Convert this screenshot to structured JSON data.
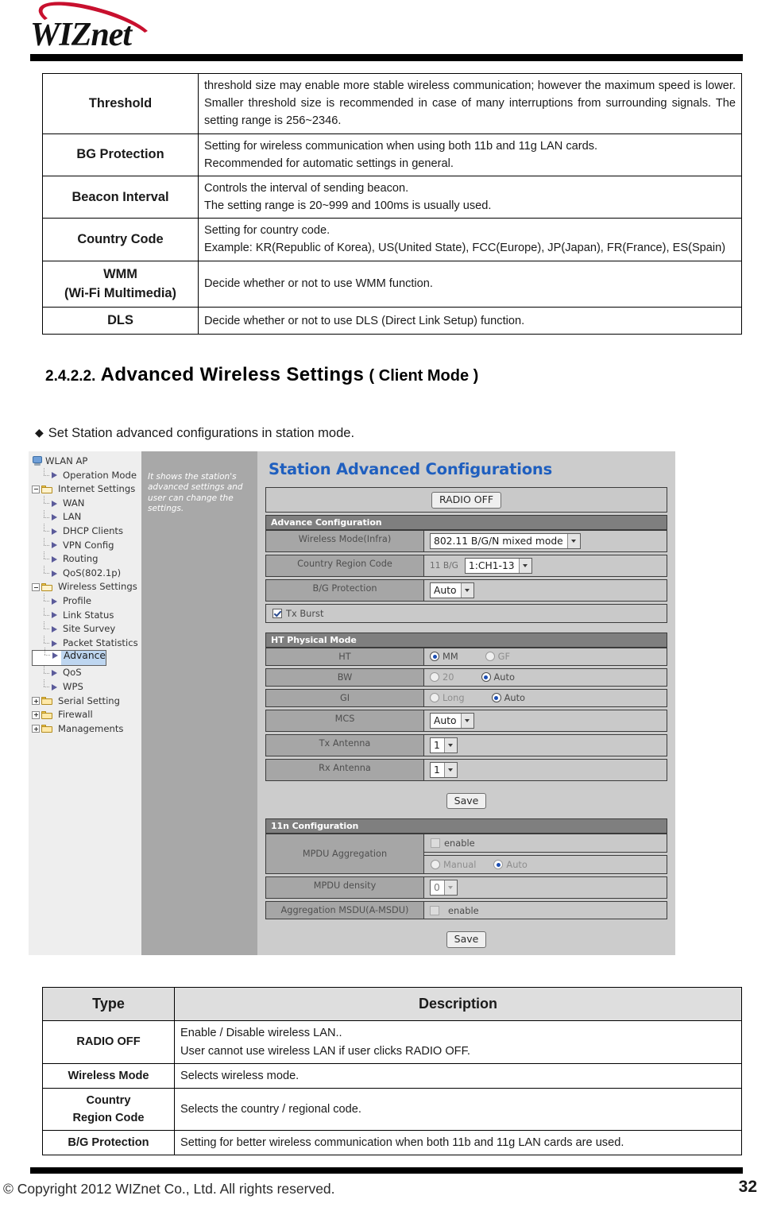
{
  "header": {
    "logo_text": "WIZnet"
  },
  "threshold_table": {
    "rows": [
      {
        "label": "Threshold",
        "lines": [
          "threshold size may enable more stable wireless communication; however the maximum speed is lower. Smaller threshold size is recommended in case of many interruptions from surrounding signals. The setting range is 256~2346."
        ]
      },
      {
        "label": "BG Protection",
        "lines": [
          "Setting for wireless communication when using both 11b and 11g LAN cards.",
          "Recommended for automatic settings in general."
        ]
      },
      {
        "label": "Beacon Interval",
        "lines": [
          "Controls the interval of sending beacon.",
          "The setting range is 20~999 and 100ms is usually used."
        ]
      },
      {
        "label": "Country Code",
        "lines": [
          "Setting for country code.",
          "Example: KR(Republic of Korea), US(United State), FCC(Europe), JP(Japan), FR(France), ES(Spain)"
        ]
      },
      {
        "label": "WMM\n(Wi-Fi Multimedia)",
        "label_line1": "WMM",
        "label_line2": "(Wi-Fi Multimedia)",
        "lines": [
          "Decide whether or not to use WMM function."
        ]
      },
      {
        "label": "DLS",
        "lines": [
          "Decide whether or not to use DLS (Direct Link Setup) function."
        ]
      }
    ]
  },
  "section": {
    "number": "2.4.2.2.",
    "title": "Advanced  Wireless  Settings",
    "paren": "( Client Mode )",
    "bullet_char": "◆",
    "bullet_text": "Set Station advanced configurations in station mode."
  },
  "screenshot": {
    "tree": [
      {
        "label": "WLAN AP",
        "icon": "computer-icon",
        "indent": 0,
        "selected": false,
        "expander": "none"
      },
      {
        "label": "Operation Mode",
        "icon": "arrow-icon",
        "indent": 1,
        "selected": false,
        "expander": "none"
      },
      {
        "label": "Internet Settings",
        "icon": "folder-open-icon",
        "indent": 0,
        "selected": false,
        "expander": "minus"
      },
      {
        "label": "WAN",
        "icon": "arrow-icon",
        "indent": 2,
        "selected": false,
        "expander": "none"
      },
      {
        "label": "LAN",
        "icon": "arrow-icon",
        "indent": 2,
        "selected": false,
        "expander": "none"
      },
      {
        "label": "DHCP Clients",
        "icon": "arrow-icon",
        "indent": 2,
        "selected": false,
        "expander": "none"
      },
      {
        "label": "VPN Config",
        "icon": "arrow-icon",
        "indent": 2,
        "selected": false,
        "expander": "none"
      },
      {
        "label": "Routing",
        "icon": "arrow-icon",
        "indent": 2,
        "selected": false,
        "expander": "none"
      },
      {
        "label": "QoS(802.1p)",
        "icon": "arrow-icon",
        "indent": 2,
        "selected": false,
        "expander": "none"
      },
      {
        "label": "Wireless Settings",
        "icon": "folder-open-icon",
        "indent": 0,
        "selected": false,
        "expander": "minus"
      },
      {
        "label": "Profile",
        "icon": "arrow-icon",
        "indent": 2,
        "selected": false,
        "expander": "none"
      },
      {
        "label": "Link Status",
        "icon": "arrow-icon",
        "indent": 2,
        "selected": false,
        "expander": "none"
      },
      {
        "label": "Site Survey",
        "icon": "arrow-icon",
        "indent": 2,
        "selected": false,
        "expander": "none"
      },
      {
        "label": "Packet Statistics",
        "icon": "arrow-icon",
        "indent": 2,
        "selected": false,
        "expander": "none"
      },
      {
        "label": "Advance",
        "icon": "arrow-icon",
        "indent": 2,
        "selected": true,
        "expander": "none"
      },
      {
        "label": "QoS",
        "icon": "arrow-icon",
        "indent": 2,
        "selected": false,
        "expander": "none"
      },
      {
        "label": "WPS",
        "icon": "arrow-icon",
        "indent": 2,
        "selected": false,
        "expander": "none"
      },
      {
        "label": "Serial Setting",
        "icon": "folder-icon",
        "indent": 0,
        "selected": false,
        "expander": "plus"
      },
      {
        "label": "Firewall",
        "icon": "folder-icon",
        "indent": 0,
        "selected": false,
        "expander": "plus"
      },
      {
        "label": "Managements",
        "icon": "folder-icon",
        "indent": 0,
        "selected": false,
        "expander": "plus"
      }
    ],
    "hint": "It shows the station's advanced settings and user can change the settings.",
    "panel_title": "Station Advanced Configurations",
    "radio_off_button": "RADIO OFF",
    "advance_configuration": {
      "band": "Advance Configuration",
      "wireless_mode": {
        "label": "Wireless Mode(Infra)",
        "value": "802.11 B/G/N mixed mode"
      },
      "country_region_code": {
        "label": "Country Region Code",
        "prefix": "11 B/G",
        "value": "1:CH1-13"
      },
      "bg_protection": {
        "label": "B/G Protection",
        "value": "Auto"
      },
      "tx_burst": {
        "label": "Tx Burst",
        "checked": true
      }
    },
    "ht_physical_mode": {
      "band": "HT Physical Mode",
      "ht": {
        "label": "HT",
        "options": [
          "MM",
          "GF"
        ],
        "selected": "MM"
      },
      "bw": {
        "label": "BW",
        "options": [
          "20",
          "Auto"
        ],
        "selected": "Auto"
      },
      "gi": {
        "label": "GI",
        "options": [
          "Long",
          "Auto"
        ],
        "selected": "Auto"
      },
      "mcs": {
        "label": "MCS",
        "value": "Auto"
      },
      "tx_antenna": {
        "label": "Tx Antenna",
        "value": "1"
      },
      "rx_antenna": {
        "label": "Rx Antenna",
        "value": "1"
      }
    },
    "save_button_1": "Save",
    "eleven_n_configuration": {
      "band": "11n Configuration",
      "mpdu_aggregation": {
        "label": "MPDU Aggregation",
        "enable_label": "enable",
        "enabled": false,
        "options": [
          "Manual",
          "Auto"
        ],
        "selected": "Auto"
      },
      "mpdu_density": {
        "label": "MPDU density",
        "value": "0"
      },
      "aggregation_msdu": {
        "label": "Aggregation MSDU(A-MSDU)",
        "enable_label": "enable",
        "enabled": false
      }
    },
    "save_button_2": "Save"
  },
  "type_table": {
    "header": {
      "type": "Type",
      "description": "Description"
    },
    "rows": [
      {
        "type": "RADIO OFF",
        "lines": [
          "Enable / Disable wireless LAN..",
          "User cannot use wireless LAN if user clicks RADIO OFF."
        ]
      },
      {
        "type": "Wireless Mode",
        "lines": [
          "Selects wireless mode."
        ]
      },
      {
        "type": "Country\nRegion Code",
        "type_line1": "Country",
        "type_line2": "Region Code",
        "lines": [
          "Selects the country / regional code."
        ]
      },
      {
        "type": "B/G Protection",
        "lines": [
          "Setting for better wireless communication when both 11b and 11g LAN cards are used."
        ]
      }
    ]
  },
  "footer": {
    "copyright": "© Copyright 2012 WIZnet Co., Ltd. All rights reserved.",
    "page_number": "32"
  }
}
